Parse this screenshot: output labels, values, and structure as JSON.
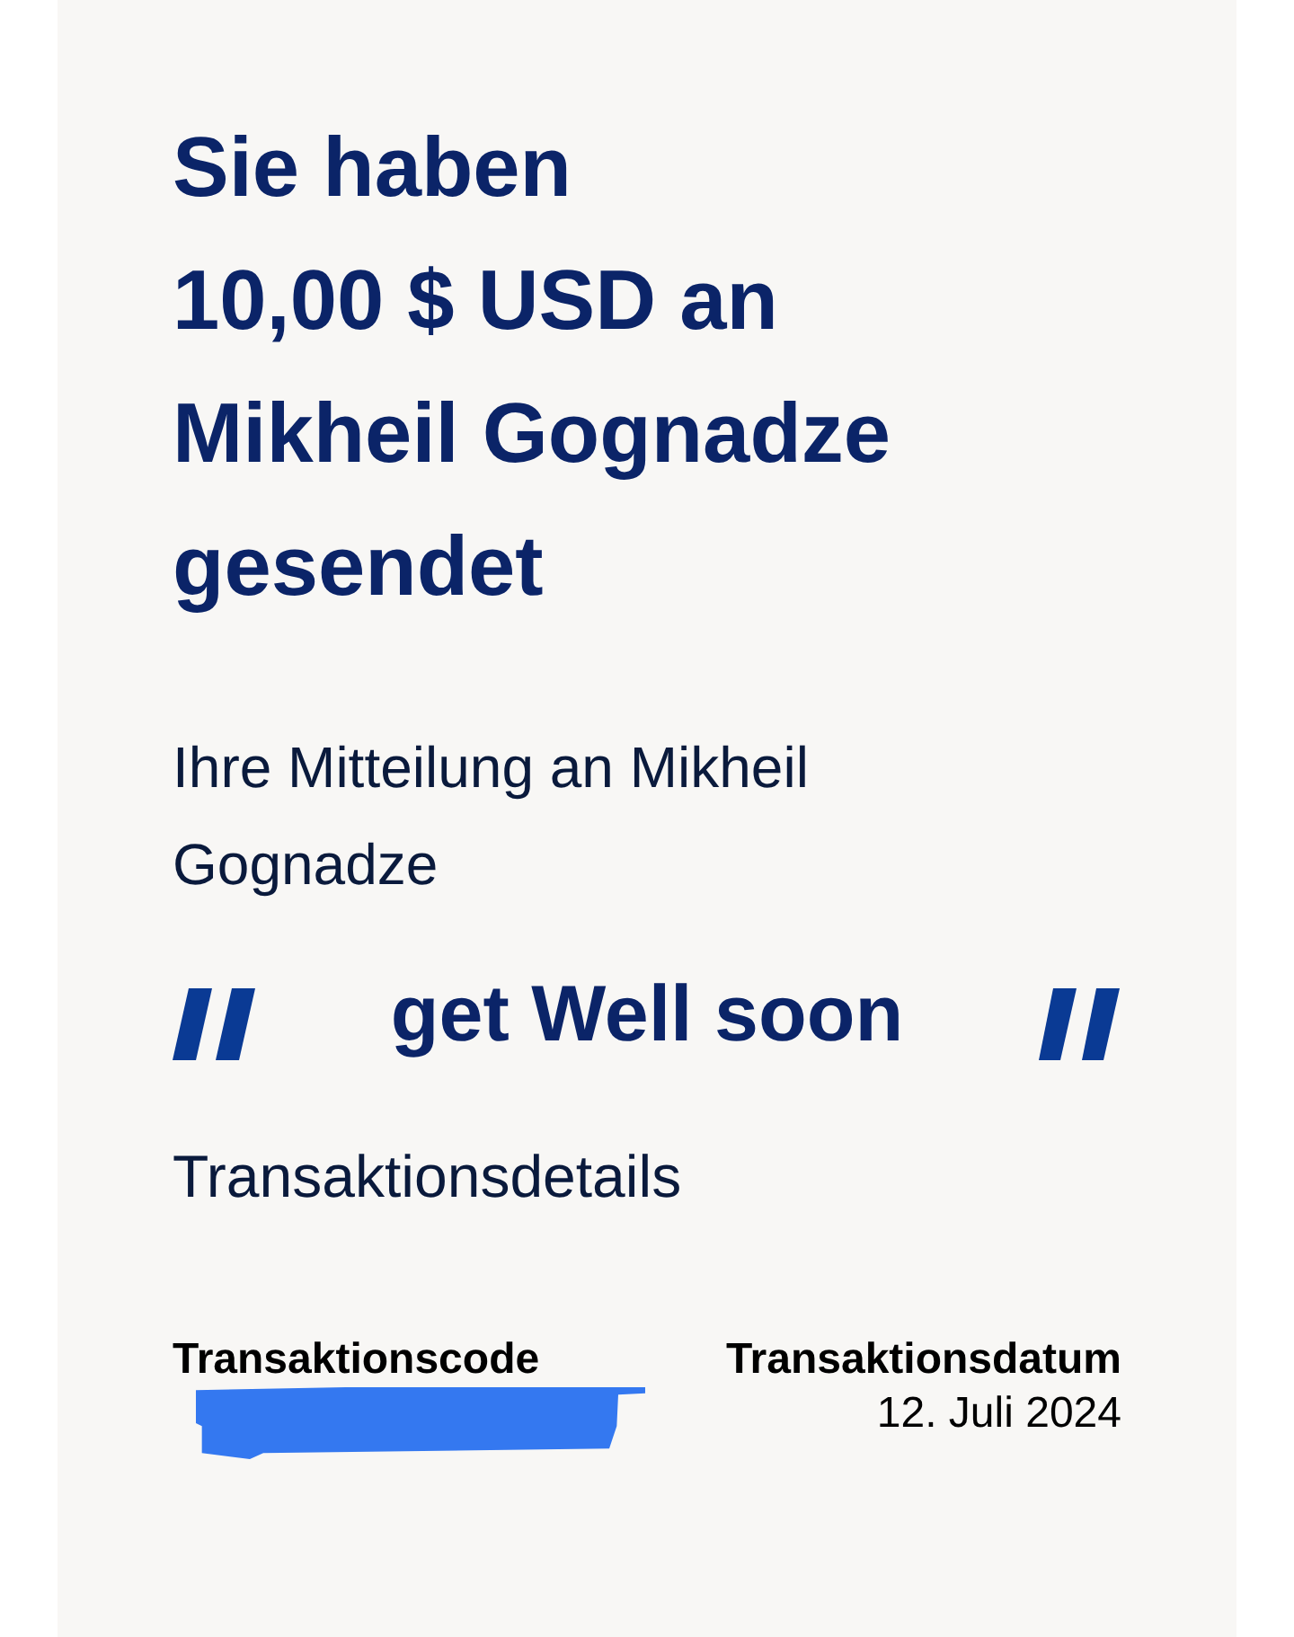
{
  "heading": "Sie haben\n10,00 $ USD an\nMikheil Gognadze\ngesendet",
  "message_intro": "Ihre Mitteilung an Mikheil Gognadze",
  "message": "get Well soon",
  "details_title": "Transaktionsdetails",
  "details": [
    {
      "label": "Transaktionscode"
    },
    {
      "label": "Transaktionsdatum",
      "value": "12. Juli 2024"
    }
  ]
}
